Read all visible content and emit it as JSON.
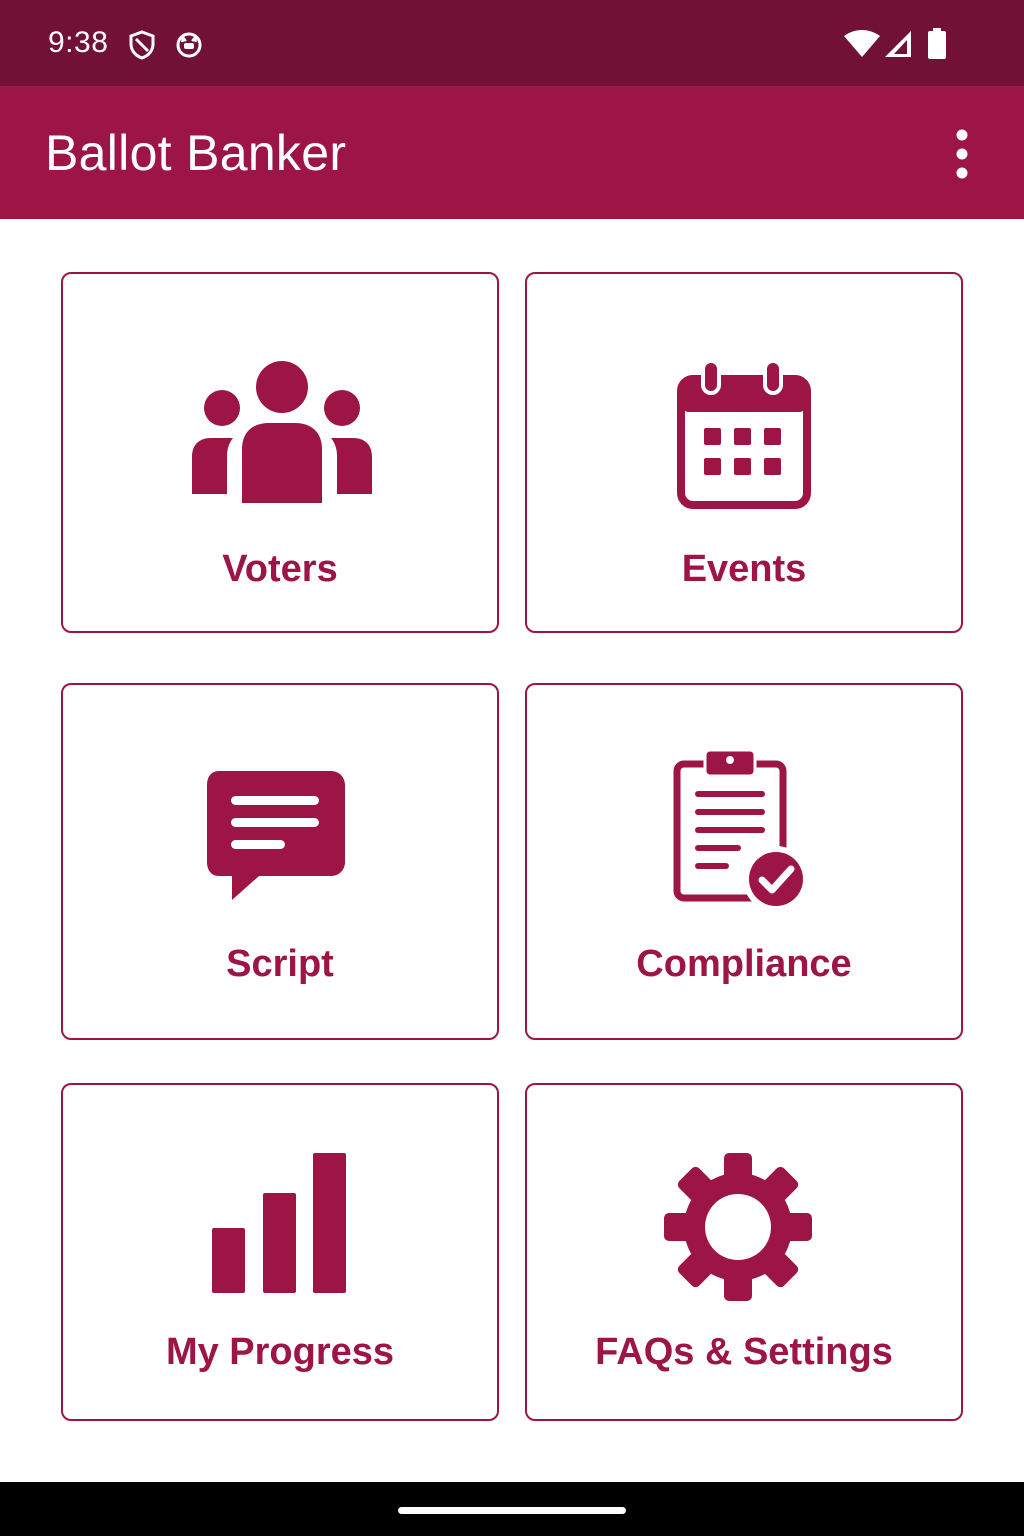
{
  "status_bar": {
    "time": "9:38",
    "icons": [
      "shield-icon",
      "cat-icon",
      "wifi-icon",
      "signal-icon",
      "battery-icon"
    ]
  },
  "app_bar": {
    "title": "Ballot Banker",
    "menu_icon": "more-vert-icon"
  },
  "tiles": [
    {
      "label": "Voters",
      "icon": "people-icon"
    },
    {
      "label": "Events",
      "icon": "calendar-icon"
    },
    {
      "label": "Script",
      "icon": "chat-icon"
    },
    {
      "label": "Compliance",
      "icon": "clipboard-check-icon"
    },
    {
      "label": "My Progress",
      "icon": "bar-chart-icon"
    },
    {
      "label": "FAQs & Settings",
      "icon": "gear-icon"
    }
  ],
  "colors": {
    "status_bar": "#721136",
    "primary": "#9c1544",
    "background": "#ffffff"
  }
}
